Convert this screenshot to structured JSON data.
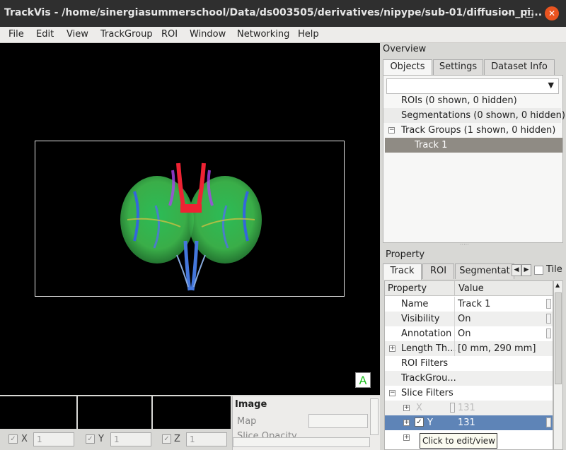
{
  "window": {
    "title": "TrackVis - /home/sinergiasummerschool/Data/ds003505/derivatives/nipype/sub-01/diffusion_pi...",
    "minimize_glyph": "–",
    "maximize_glyph": "□",
    "close_glyph": "✕"
  },
  "menu": [
    "File",
    "Edit",
    "View",
    "TrackGroup",
    "ROI",
    "Window",
    "Networking",
    "Help"
  ],
  "viewport": {
    "orientation_label": "A"
  },
  "bottom_controls": {
    "axes": [
      {
        "label": "X",
        "value": "1",
        "checked": true
      },
      {
        "label": "Y",
        "value": "1",
        "checked": true
      },
      {
        "label": "Z",
        "value": "1",
        "checked": true
      }
    ]
  },
  "image_panel": {
    "heading": "Image",
    "map_label": "Map",
    "slice_opacity_label": "Slice Opacity"
  },
  "overview": {
    "heading": "Overview",
    "tabs": [
      "Objects",
      "Settings",
      "Dataset Info"
    ],
    "tree": [
      {
        "label": "ROIs (0 shown, 0 hidden)"
      },
      {
        "label": "Segmentations (0 shown, 0 hidden)"
      },
      {
        "label": "Track Groups (1 shown, 0 hidden)",
        "expander": "−"
      },
      {
        "label": "Track 1"
      }
    ]
  },
  "property": {
    "heading": "Property",
    "tabs": [
      "Track",
      "ROI",
      "Segmentat"
    ],
    "tile_label": "Tile",
    "columns": [
      "Property",
      "Value"
    ],
    "rows": [
      {
        "key": "Name",
        "value": "Track 1"
      },
      {
        "key": "Visibility",
        "value": "On"
      },
      {
        "key": "Annotation",
        "value": "On"
      },
      {
        "key": "Length Th...",
        "value": "[0 mm,  290 mm]",
        "expander": "+"
      },
      {
        "key": "ROI Filters",
        "value": ""
      },
      {
        "key": "TrackGrou...",
        "value": ""
      },
      {
        "key": "Slice Filters",
        "value": "",
        "expander": "−"
      },
      {
        "key": "X",
        "value": "131",
        "expander": "+"
      },
      {
        "key": "Y",
        "value": "131",
        "expander": "+",
        "checked": true
      },
      {
        "key": "",
        "value": "",
        "expander": "+"
      }
    ]
  },
  "tooltip": "Click to edit/view",
  "colors": {
    "selection": "#5e84b7",
    "tree_selection": "#8f8b84",
    "orientation_text": "#1fbf1f",
    "close_button": "#e95420"
  }
}
